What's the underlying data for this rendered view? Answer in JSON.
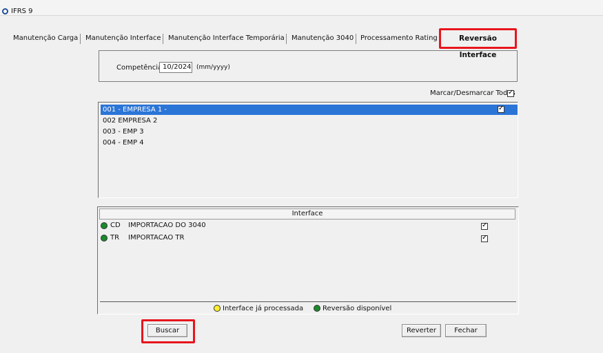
{
  "window": {
    "title": "IFRS 9"
  },
  "tabs": [
    {
      "label": "Manutenção Carga"
    },
    {
      "label": "Manutenção Interface"
    },
    {
      "label": "Manutenção Interface Temporária"
    },
    {
      "label": "Manutenção 3040"
    },
    {
      "label": "Processamento Rating"
    },
    {
      "label": "Reversão Interface",
      "active": true
    }
  ],
  "competencia": {
    "label": "Competência",
    "value": "10/2024",
    "format_hint": "(mm/yyyy)"
  },
  "select_all": {
    "label": "Marcar/Desmarcar Todas",
    "checked": true
  },
  "empresas": [
    {
      "label": "001 - EMPRESA 1 -",
      "selected": true,
      "checked": true
    },
    {
      "label": "002  EMPRESA 2",
      "selected": false
    },
    {
      "label": "003 - EMP 3",
      "selected": false
    },
    {
      "label": "004 - EMP 4",
      "selected": false
    }
  ],
  "interface_table": {
    "header": "Interface",
    "rows": [
      {
        "status": "green",
        "code": "CD",
        "name": "IMPORTACAO DO 3040",
        "checked": true
      },
      {
        "status": "green",
        "code": "TR",
        "name": "IMPORTACAO TR",
        "checked": true
      }
    ]
  },
  "legend": {
    "processed": "Interface já processada",
    "available": "Reversão disponível"
  },
  "buttons": {
    "buscar": "Buscar",
    "reverter": "Reverter",
    "fechar": "Fechar"
  },
  "colors": {
    "selection": "#2b75d7",
    "highlight": "#e8141c",
    "status_green": "#1b8a2b",
    "status_yellow": "#ffef2b"
  }
}
